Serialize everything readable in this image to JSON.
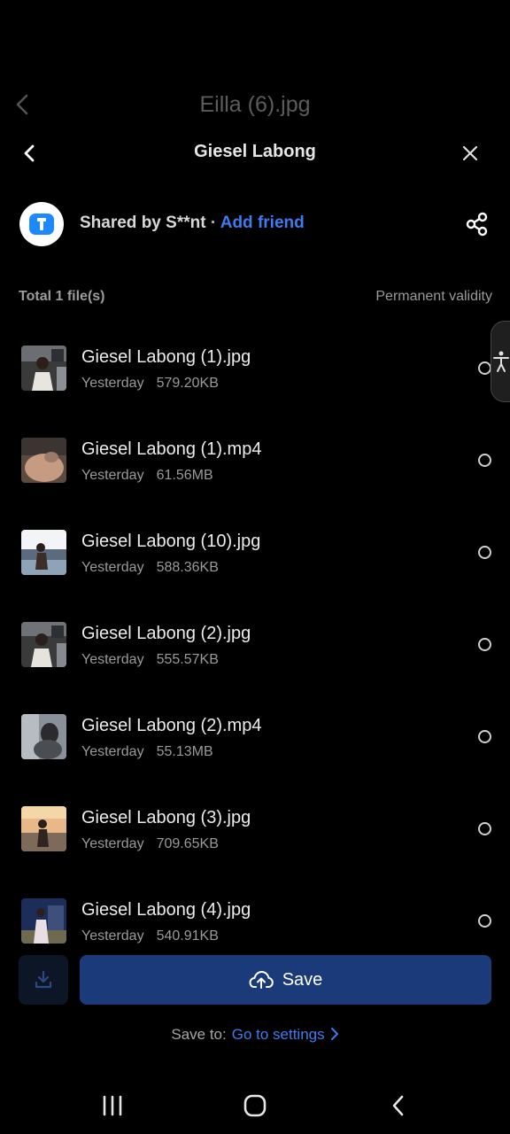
{
  "background": {
    "title": "Eilla (6).jpg"
  },
  "header": {
    "title": "Giesel Labong"
  },
  "share": {
    "shared_by": "Shared by S**nt",
    "separator": " · ",
    "add_friend": "Add friend",
    "logo_color": "#1E88FF"
  },
  "summary": {
    "total": "Total 1 file(s)",
    "validity": "Permanent validity"
  },
  "files": [
    {
      "name": "Giesel Labong (1).jpg",
      "date": "Yesterday",
      "size": "579.20KB"
    },
    {
      "name": "Giesel Labong (1).mp4",
      "date": "Yesterday",
      "size": "61.56MB"
    },
    {
      "name": "Giesel Labong (10).jpg",
      "date": "Yesterday",
      "size": "588.36KB"
    },
    {
      "name": "Giesel Labong (2).jpg",
      "date": "Yesterday",
      "size": "555.57KB"
    },
    {
      "name": "Giesel Labong (2).mp4",
      "date": "Yesterday",
      "size": "55.13MB"
    },
    {
      "name": "Giesel Labong (3).jpg",
      "date": "Yesterday",
      "size": "709.65KB"
    },
    {
      "name": "Giesel Labong (4).jpg",
      "date": "Yesterday",
      "size": "540.91KB"
    }
  ],
  "actions": {
    "save": "Save",
    "save_to_label": "Save to:",
    "settings_link": "Go to settings"
  },
  "colors": {
    "accent": "#3D7BF0",
    "save_button": "#1A3A7A",
    "background": "#000000"
  }
}
